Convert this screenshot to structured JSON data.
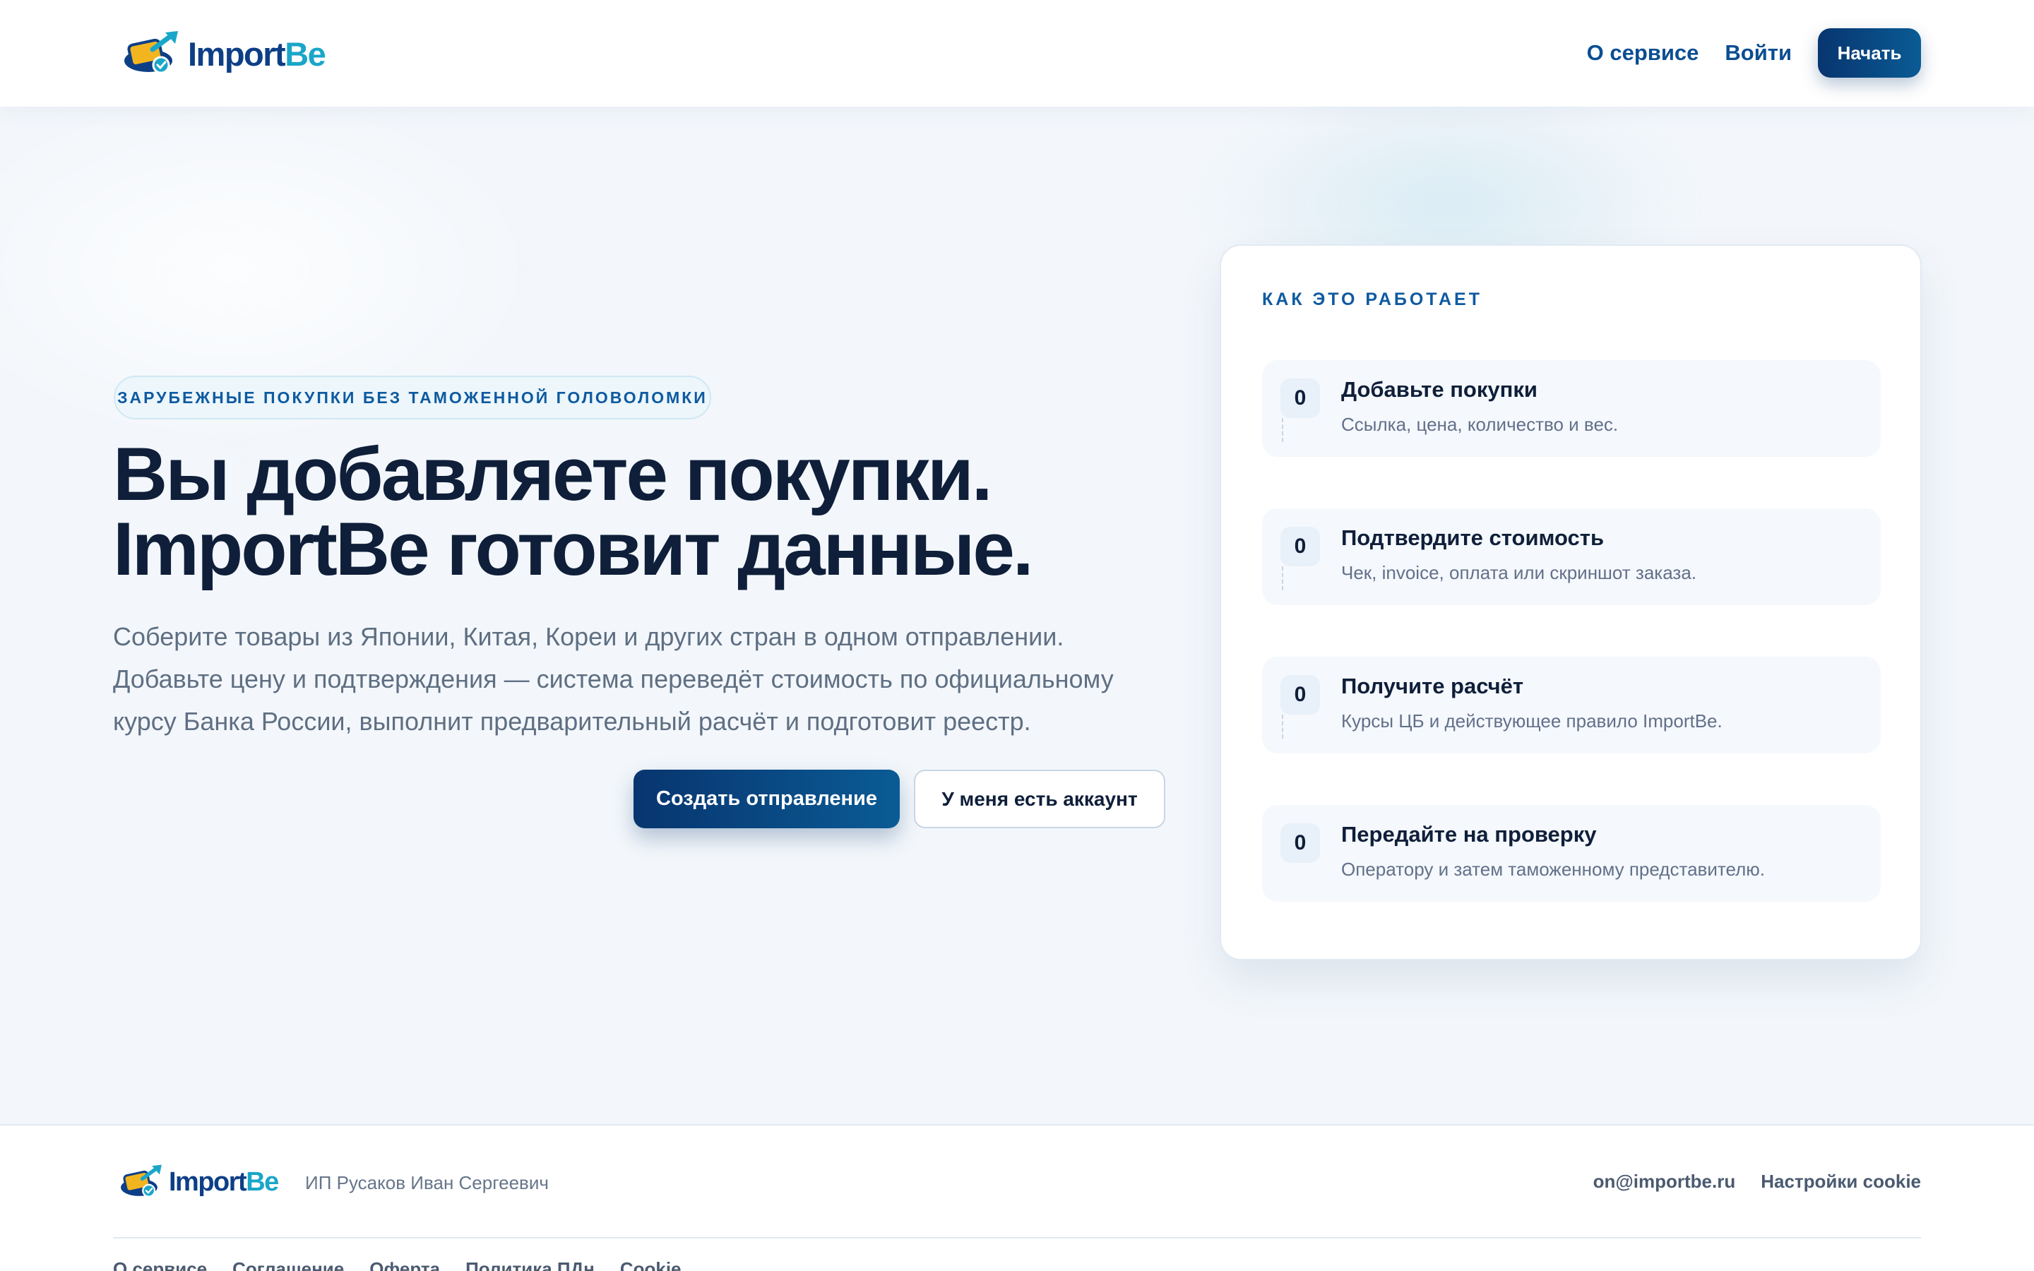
{
  "brand": {
    "name_part1": "Import",
    "name_part2": "Be",
    "colors": {
      "navy": "#0d3f86",
      "teal": "#1aa6c8",
      "accent": "#f2b520"
    }
  },
  "header": {
    "nav": [
      "О сервисе",
      "Войти"
    ],
    "cta": "Начать"
  },
  "hero": {
    "badge": "ЗАРУБЕЖНЫЕ ПОКУПКИ БЕЗ ТАМОЖЕННОЙ ГОЛОВОЛОМКИ",
    "title_line1": "Вы добавляете покупки.",
    "title_line2": "ImportBe готовит данные.",
    "text_lines": [
      "Соберите товары из Японии, Китая, Кореи и других стран в одном отправлении.",
      "Добавьте цену и подтверждения — система переведёт стоимость по официальному",
      "курсу Банка России, выполнит предварительный расчёт и подготовит реестр."
    ],
    "primary_button": "Создать отправление",
    "secondary_button": "У меня есть аккаунт"
  },
  "how_it_works": {
    "title": "КАК ЭТО РАБОТАЕТ",
    "steps": [
      {
        "num": "0",
        "title": "Добавьте покупки",
        "desc": "Ссылка, цена, количество и вес."
      },
      {
        "num": "0",
        "title": "Подтвердите стоимость",
        "desc": "Чек, invoice, оплата или скриншот заказа."
      },
      {
        "num": "0",
        "title": "Получите расчёт",
        "desc": "Курсы ЦБ и действующее правило ImportBe."
      },
      {
        "num": "0",
        "title": "Передайте на проверку",
        "desc": "Оператору и затем таможенному представителю."
      }
    ]
  },
  "footer": {
    "company": "ИП Русаков Иван Сергеевич",
    "email": "on@importbe.ru",
    "cookie_settings": "Настройки cookie",
    "links": [
      "О сервисе",
      "Соглашение",
      "Оферта",
      "Политика ПДн",
      "Cookie"
    ]
  }
}
